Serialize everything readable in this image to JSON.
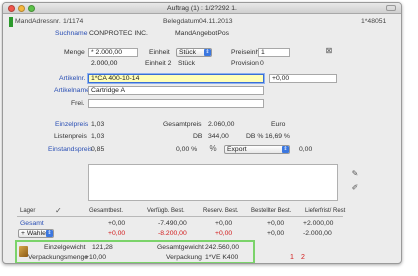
{
  "window": {
    "title": "Auftrag (1) : 1/2?292 1."
  },
  "header": {
    "mand_adressnr_label": "MandAdressnr.",
    "mand_adressnr_value": "1/1174",
    "belegdatum_label": "Belegdatum",
    "belegdatum_value": "04.11.2013",
    "belegnr": "1*48051"
  },
  "customer": {
    "suchname_label": "Suchname",
    "suchname_value": "CONPROTEC INC.",
    "mand_angebot_label": "MandAngebotPos"
  },
  "quantities": {
    "menge_label": "Menge",
    "menge_value": "* 2.000,00",
    "einheit_label": "Einheit",
    "einheit_value": "Stück",
    "menge2_value": "2.000,00",
    "einheit2_label": "Einheit 2",
    "einheit2_value": "Stück",
    "preiseinheit_label": "Preiseinheit",
    "preiseinheit_value": "1",
    "provision_label": "Provision",
    "provision_value": "0"
  },
  "article": {
    "artikelnr_label": "Artikelnr.",
    "artikelnr_value": "1*CA 400-10-14",
    "artikelnr_extra": "+0,00",
    "artikelname_label": "Artikelname",
    "artikelname_value": "Cartridge A",
    "frei_label": "Frei."
  },
  "prices": {
    "einzelpreis_label": "Einzelpreis",
    "einzelpreis_value": "1,03",
    "gesamtpreis_label": "Gesamtpreis",
    "gesamtpreis_value": "2.060,00",
    "currency": "Euro",
    "listenpreis_label": "Listenpreis",
    "listenpreis_value": "1,03",
    "db_label": "DB",
    "db_value": "344,00",
    "db_pct_label": "DB %",
    "db_pct_value": "16,69 %",
    "einstandspreis_label": "Einstandspreis",
    "einstandspreis_value": "0,85",
    "rabatt_pct": "0,00 %",
    "export_select": "Export",
    "export_value": "0,00"
  },
  "stock_table": {
    "headers": [
      "Lager",
      "Gesamtbest.",
      "Verfügb. Best.",
      "Reserv. Best.",
      "Bestellter Best.",
      "Lieferfrist/ Rest"
    ],
    "rows": [
      {
        "lager": "Gesamt",
        "values": [
          "+0,00",
          "-7.490,00",
          "+0,00",
          "+0,00",
          "+2.000,00"
        ],
        "red": [
          false,
          false,
          false,
          false,
          false
        ]
      },
      {
        "lager": "+ Wahlen",
        "values": [
          "+0,00",
          "-8.200,00",
          "+0,00",
          "+0,00",
          "-2.000,00"
        ],
        "red": [
          true,
          true,
          true,
          false,
          false
        ]
      }
    ]
  },
  "summary": {
    "einzelgewicht_label": "Einzelgewicht",
    "einzelgewicht_value": "121,28",
    "gesamtgewicht_label": "Gesamtgewicht",
    "gesamtgewicht_value": "242.560,00",
    "verpackungsmenge_label": "Verpackungsmenge",
    "verpackungsmenge_value": "+10,00",
    "verpackung_label": "Verpackung",
    "verpackung_value": "1*VE K400"
  },
  "paging": {
    "page1": "1",
    "page2": "2"
  },
  "colors": {
    "accent_blue": "#2a4fb5",
    "highlight_green": "#7bd36a",
    "red": "#d21b1b",
    "field_yellow": "#ffffb8"
  }
}
